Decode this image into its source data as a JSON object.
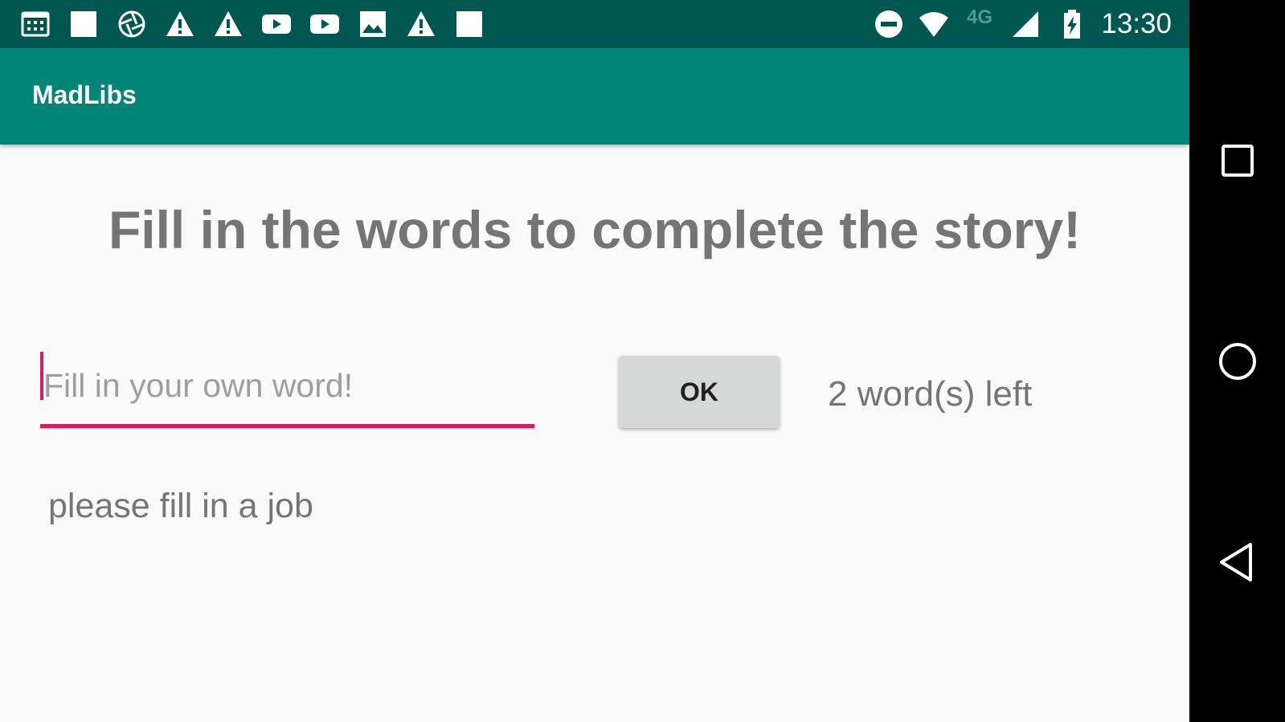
{
  "status_bar": {
    "time": "13:30",
    "network_label": "4G",
    "left_icons": [
      "calendar-icon",
      "square-icon",
      "aperture-icon",
      "warning-icon",
      "warning-icon",
      "youtube-icon",
      "youtube-icon",
      "image-icon",
      "warning-icon",
      "square-icon"
    ],
    "right_icons": [
      "do-not-disturb-icon",
      "wifi-icon",
      "signal-icon",
      "battery-charging-icon"
    ]
  },
  "app_bar": {
    "title": "MadLibs"
  },
  "main": {
    "headline": "Fill in the words to complete the story!",
    "input": {
      "value": "",
      "placeholder": "Fill in your own word!"
    },
    "ok_label": "OK",
    "words_left": "2 word(s) left",
    "prompt": "please fill in a job"
  },
  "nav_bar": {
    "buttons": [
      "recents-icon",
      "home-icon",
      "back-icon"
    ]
  },
  "colors": {
    "status_bar": "#00574f",
    "app_bar": "#008577",
    "accent": "#d81b60",
    "text_gray": "#757575",
    "button_bg": "#d6d7d7"
  }
}
